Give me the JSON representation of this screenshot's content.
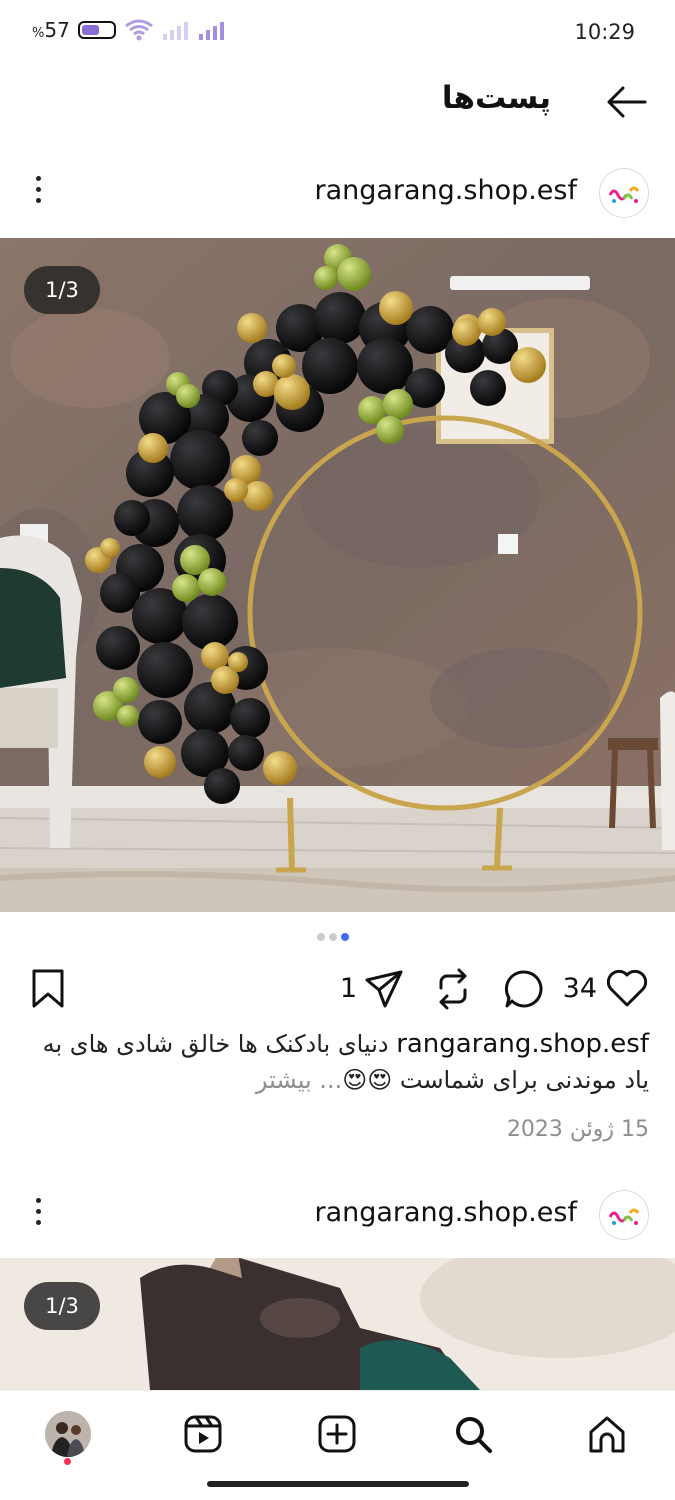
{
  "status_bar": {
    "battery_percent": "57",
    "battery_symbol": "%",
    "battery_level": 0.57,
    "time": "10:29",
    "icons": [
      "battery-icon",
      "wifi-icon",
      "signal-icon",
      "signal-icon"
    ]
  },
  "header": {
    "title": "پست‌ها",
    "back_icon": "arrow-right-icon"
  },
  "posts": [
    {
      "username": "rangarang.shop.esf",
      "avatar_logo_text": "رنگارنگ",
      "image_counter": "1/3",
      "carousel_dots": 3,
      "carousel_active_dot": 3,
      "share_count": "1",
      "like_count": "34",
      "caption_user": "rangarang.shop.esf",
      "caption_text": " دنیای بادکنک ها خالق شادی های به یاد موندنی برای شماست 😍😍",
      "caption_more": "... بیشتر",
      "date": "15 ژوئن 2023"
    },
    {
      "username": "rangarang.shop.esf",
      "avatar_logo_text": "رنگارنگ",
      "image_counter": "1/3"
    }
  ],
  "colors": {
    "accent_blue": "#3f6cf2",
    "battery_purple": "#8b6bd6",
    "notification_red": "#ff2d55",
    "muted_text": "#8e8e8e"
  },
  "bottom_nav": [
    "profile-avatar",
    "reels-icon",
    "add-post-icon",
    "search-icon",
    "home-icon"
  ]
}
